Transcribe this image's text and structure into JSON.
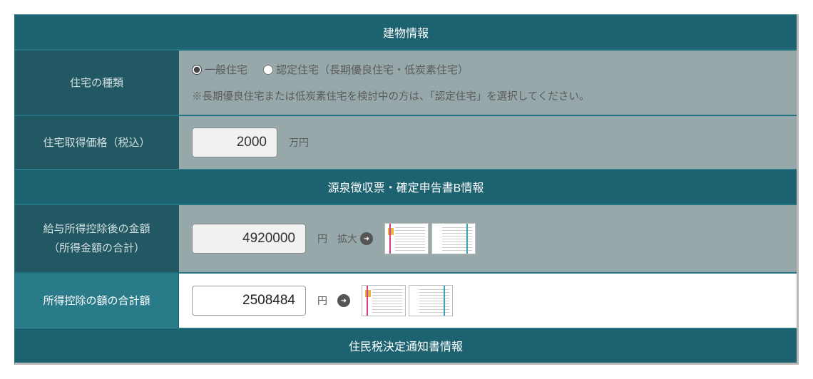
{
  "sections": {
    "building": {
      "title": "建物情報"
    },
    "tax_slip": {
      "title": "源泉徴収票・確定申告書B情報"
    },
    "resident_tax": {
      "title": "住民税決定通知書情報"
    }
  },
  "house_type": {
    "label": "住宅の種類",
    "option_general": "一般住宅",
    "option_certified": "認定住宅（長期優良住宅・低炭素住宅）",
    "note": "※長期優良住宅または低炭素住宅を検討中の方は、「認定住宅」を選択してください。",
    "selected": "general"
  },
  "price": {
    "label": "住宅取得価格（税込）",
    "value": "2000",
    "unit": "万円"
  },
  "salary_after_deduction": {
    "label_line1": "給与所得控除後の金額",
    "label_line2": "（所得金額の合計）",
    "value": "4920000",
    "unit": "円",
    "expand": "拡大"
  },
  "deduction_total": {
    "label": "所得控除の額の合計額",
    "value": "2508484",
    "unit": "円"
  }
}
